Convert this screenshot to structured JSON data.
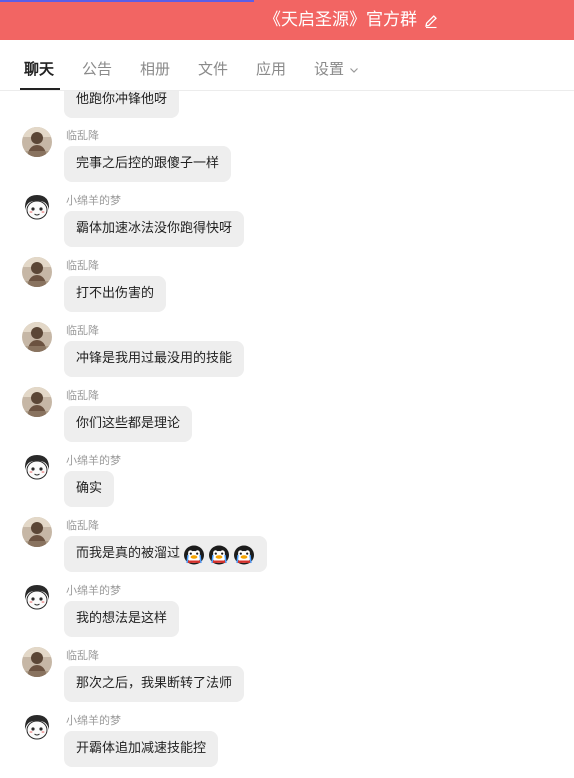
{
  "header": {
    "title": "《天启圣源》官方群",
    "bg_color": "#f26563",
    "accent_color": "#5b5ee8"
  },
  "tabs": [
    {
      "label": "聊天",
      "active": true
    },
    {
      "label": "公告",
      "active": false
    },
    {
      "label": "相册",
      "active": false
    },
    {
      "label": "文件",
      "active": false
    },
    {
      "label": "应用",
      "active": false
    },
    {
      "label": "设置",
      "active": false
    }
  ],
  "messages": [
    {
      "sender": "",
      "text": "他跑你冲锋他呀",
      "avatar": "partial"
    },
    {
      "sender": "临乱降",
      "text": "完事之后控的跟傻子一样",
      "avatar": "photo-avatar"
    },
    {
      "sender": "小绵羊的梦",
      "text": "霸体加速冰法没你跑得快呀",
      "avatar": "cartoon-avatar"
    },
    {
      "sender": "临乱降",
      "text": "打不出伤害的",
      "avatar": "photo-avatar"
    },
    {
      "sender": "临乱降",
      "text": "冲锋是我用过最没用的技能",
      "avatar": "photo-avatar"
    },
    {
      "sender": "临乱降",
      "text": "你们这些都是理论",
      "avatar": "photo-avatar"
    },
    {
      "sender": "小绵羊的梦",
      "text": "确实",
      "avatar": "cartoon-avatar"
    },
    {
      "sender": "临乱降",
      "text": "而我是真的被溜过",
      "avatar": "photo-avatar",
      "emojis": [
        "penguin-cry-emoji",
        "penguin-cry-emoji",
        "penguin-cry-emoji"
      ]
    },
    {
      "sender": "小绵羊的梦",
      "text": "我的想法是这样",
      "avatar": "cartoon-avatar"
    },
    {
      "sender": "临乱降",
      "text": "那次之后，我果断转了法师",
      "avatar": "photo-avatar"
    },
    {
      "sender": "小绵羊的梦",
      "text": "开霸体追加减速技能控",
      "avatar": "cartoon-avatar"
    }
  ]
}
